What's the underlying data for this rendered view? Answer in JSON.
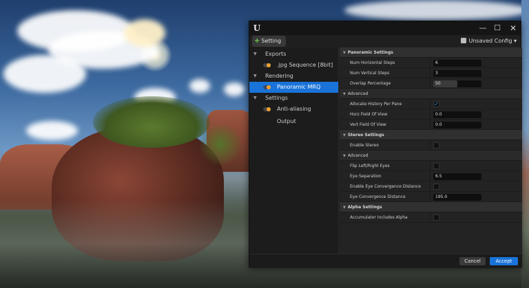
{
  "window": {
    "minimize_glyph": "—",
    "maximize_glyph": "☐",
    "close_glyph": "✕"
  },
  "toolbar": {
    "setting_label": "Setting",
    "config_label": "Unsaved Config",
    "config_chevron": "▾"
  },
  "tree": [
    {
      "label": "Exports",
      "type": "group",
      "expanded": true
    },
    {
      "label": ".jpg Sequence [8bit]",
      "type": "item",
      "toggle": true,
      "selected": false
    },
    {
      "label": "Rendering",
      "type": "group",
      "expanded": true
    },
    {
      "label": "Panoramic MRQ",
      "type": "item",
      "toggle": true,
      "selected": true
    },
    {
      "label": "Settings",
      "type": "group",
      "expanded": true
    },
    {
      "label": "Anti-aliasing",
      "type": "item",
      "toggle": true,
      "selected": false
    },
    {
      "label": "Output",
      "type": "item",
      "toggle": false,
      "selected": false
    }
  ],
  "details": {
    "panoramic_settings": {
      "title": "Panoramic Settings",
      "num_horizontal_steps": {
        "label": "Num Horizontal Steps",
        "value": "6"
      },
      "num_vertical_steps": {
        "label": "Num Vertical Steps",
        "value": "3"
      },
      "overlap_percentage": {
        "label": "Overlap Percentage",
        "value": "50",
        "fill_fraction": 0.5
      }
    },
    "advanced_1": {
      "title": "Advanced",
      "allocate_history_per_pane": {
        "label": "Allocate History Per Pane",
        "checked": true
      },
      "horz_fov": {
        "label": "Horz Field Of View",
        "value": "0.0"
      },
      "vert_fov": {
        "label": "Vert Field Of View",
        "value": "0.0"
      }
    },
    "stereo_settings": {
      "title": "Stereo Settings",
      "enable_stereo": {
        "label": "Enable Stereo",
        "checked": false
      }
    },
    "advanced_2": {
      "title": "Advanced",
      "flip_eyes": {
        "label": "Flip Left/Right Eyes",
        "checked": false
      },
      "eye_separation": {
        "label": "Eye Separation",
        "value": "6.5"
      },
      "enable_eye_convergence": {
        "label": "Enable Eye Convergence Distance",
        "checked": false
      },
      "eye_convergence_distance": {
        "label": "Eye Convergence Distance",
        "value": "195.0"
      }
    },
    "alpha_settings": {
      "title": "Alpha Settings",
      "accumulator_includes_alpha": {
        "label": "Accumulator Includes Alpha",
        "checked": false
      }
    }
  },
  "footer": {
    "cancel_label": "Cancel",
    "accept_label": "Accept"
  },
  "colors": {
    "accent": "#1a73d9",
    "toggle_on": "#f0a232",
    "add_green": "#6fcf4a"
  }
}
